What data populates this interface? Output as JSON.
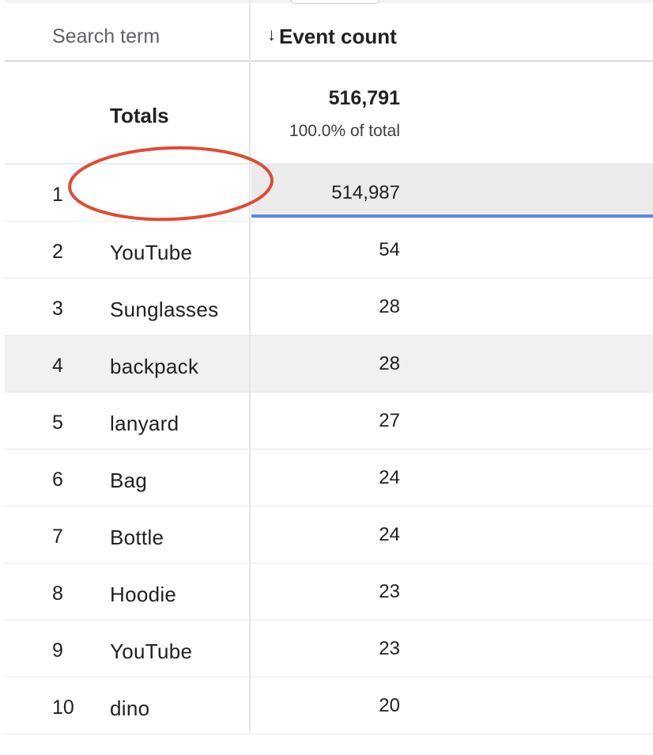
{
  "header": {
    "search_term_label": "Search term",
    "event_count_label": "Event count",
    "sort_icon": "arrow-down-icon"
  },
  "totals": {
    "label": "Totals",
    "value": "516,791",
    "percent": "100.0% of total"
  },
  "rows": [
    {
      "index": "1",
      "term": "",
      "count": "514,987"
    },
    {
      "index": "2",
      "term": "YouTube",
      "count": "54"
    },
    {
      "index": "3",
      "term": "Sunglasses",
      "count": "28"
    },
    {
      "index": "4",
      "term": "backpack",
      "count": "28"
    },
    {
      "index": "5",
      "term": "lanyard",
      "count": "27"
    },
    {
      "index": "6",
      "term": "Bag",
      "count": "24"
    },
    {
      "index": "7",
      "term": "Bottle",
      "count": "24"
    },
    {
      "index": "8",
      "term": "Hoodie",
      "count": "23"
    },
    {
      "index": "9",
      "term": "YouTube",
      "count": "23"
    },
    {
      "index": "10",
      "term": "dino",
      "count": "20"
    }
  ],
  "colors": {
    "annotation": "#e04b34",
    "highlight_bar": "#5b86e5",
    "row_highlight": "#f1f1f1"
  },
  "annotation": {
    "shape": "ellipse",
    "target": "row 1 search term"
  }
}
